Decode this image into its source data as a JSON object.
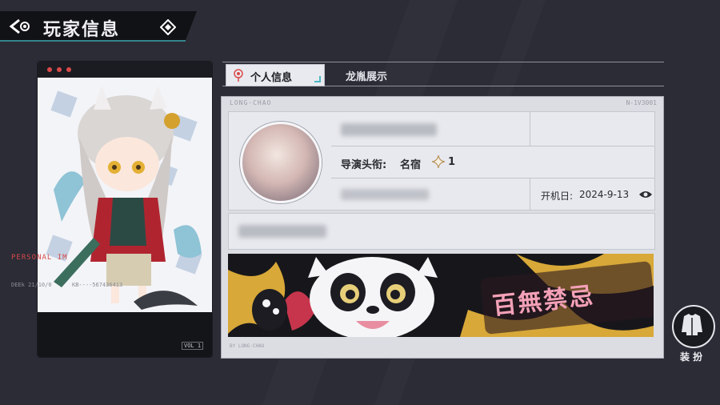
{
  "header": {
    "title": "玩家信息"
  },
  "character_card": {
    "footer_title": "PERSONAL IM",
    "footer_code": "DEEk 21/10/0",
    "footer_code2": "KB----567436413",
    "vol": "VOL 1"
  },
  "tabs": [
    {
      "label": "个人信息",
      "active": true
    },
    {
      "label": "龙胤展示",
      "active": false
    }
  ],
  "panel": {
    "header_text": "LONG·CHAO",
    "header_right": "N-1V3001",
    "director_title_label": "导演头衔:",
    "director_title_value": "名宿",
    "director_title_level": "1",
    "open_date_label": "开机日:",
    "open_date_value": "2024-9-13",
    "banner_text": "百無禁忌",
    "foot_text": "BY LONG·CHAO"
  },
  "outfit_button": {
    "label": "装扮"
  },
  "colors": {
    "accent": "#4fd0e0",
    "background": "#2b2c36",
    "panel": "#dcdde3",
    "banner_pink": "#f4a1b8",
    "banner_gold": "#d8a838"
  }
}
